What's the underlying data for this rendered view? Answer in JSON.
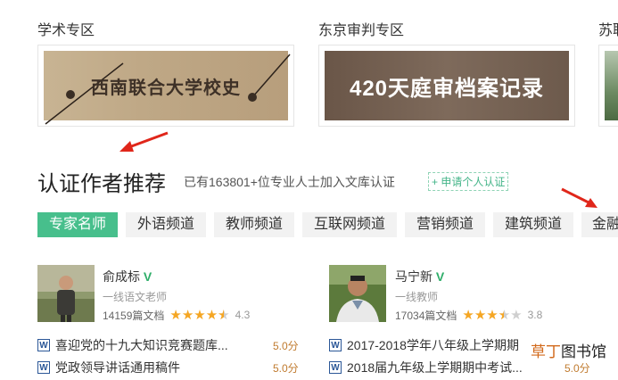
{
  "zones": [
    {
      "title": "学术专区",
      "banner_text": "西南联合大学校史"
    },
    {
      "title": "东京审判专区",
      "banner_text": "420天庭审档案记录"
    },
    {
      "title": "苏联",
      "banner_text": ""
    }
  ],
  "section": {
    "title": "认证作者推荐",
    "summary_prefix": "已有",
    "summary_count": "163801",
    "summary_suffix": "+位专业人士加入文库认证",
    "apply_link": "+ 申请个人认证"
  },
  "tabs": [
    {
      "label": "专家名师",
      "active": true
    },
    {
      "label": "外语频道",
      "active": false
    },
    {
      "label": "教师频道",
      "active": false
    },
    {
      "label": "互联网频道",
      "active": false
    },
    {
      "label": "营销频道",
      "active": false
    },
    {
      "label": "建筑频道",
      "active": false
    },
    {
      "label": "金融",
      "active": false
    }
  ],
  "authors": [
    {
      "name": "俞成标",
      "badge": "V",
      "role": "一线语文老师",
      "docs_count": "14159篇文档",
      "stars": 4.5,
      "rating": "4.3",
      "documents": [
        {
          "title": "喜迎党的十九大知识竞赛题库...",
          "score": "5.0分"
        },
        {
          "title": "党政领导讲话通用稿件",
          "score": "5.0分"
        }
      ]
    },
    {
      "name": "马宁新",
      "badge": "V",
      "role": "一线教师",
      "docs_count": "17034篇文档",
      "stars": 3.5,
      "rating": "3.8",
      "documents": [
        {
          "title": "2017-2018学年八年级上学期期",
          "score": ""
        },
        {
          "title": "2018届九年级上学期期中考试...",
          "score": "5.0分"
        }
      ]
    }
  ],
  "watermark": {
    "part1": "草丁",
    "part2": "图书馆"
  },
  "colors": {
    "accent": "#47bf8c",
    "star": "#f5a623",
    "arrow": "#e0261a"
  }
}
